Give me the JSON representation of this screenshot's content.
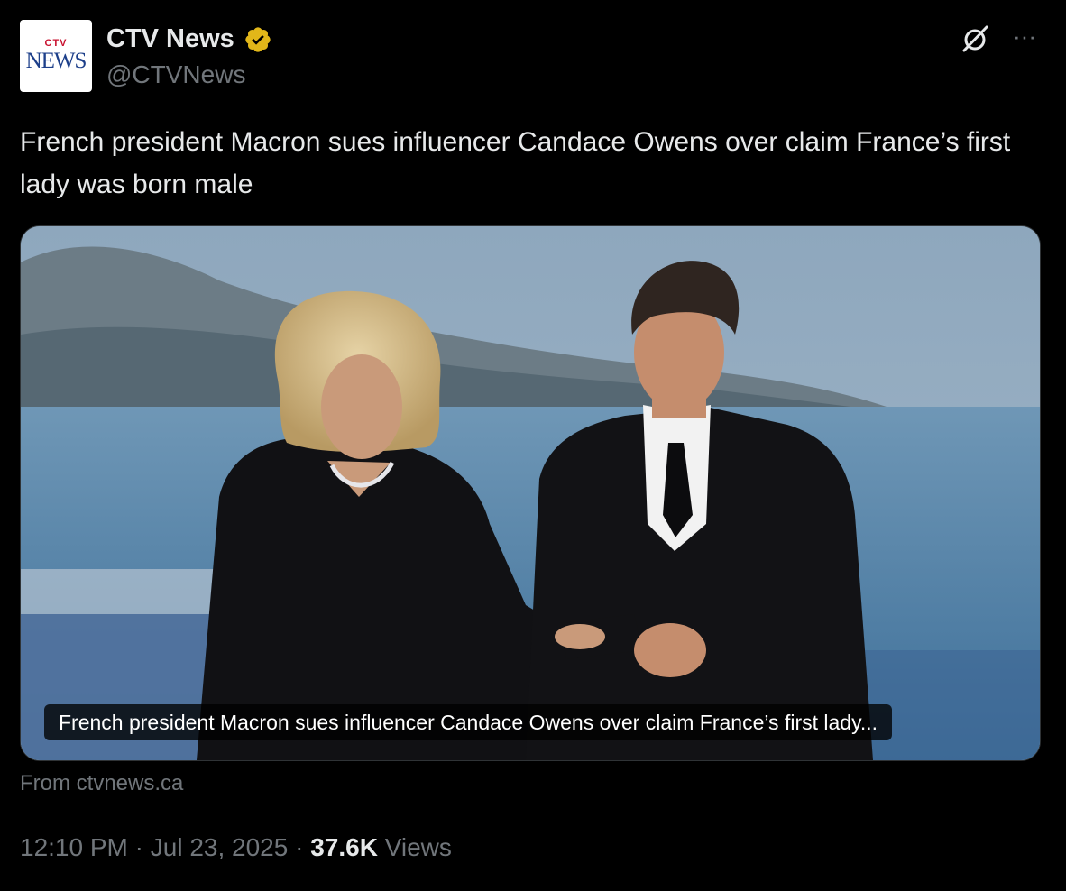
{
  "account": {
    "avatar_line1": "CTV",
    "avatar_line2": "NEWS",
    "display_name": "CTV News",
    "handle": "@CTVNews",
    "verified_color": "#e2b719"
  },
  "actions": {
    "grok_icon": "grok-icon",
    "more_icon": "more-icon",
    "more_label": "···"
  },
  "tweet": {
    "text": "French president Macron sues influencer Candace Owens over claim France’s first lady was born male"
  },
  "card": {
    "caption": "French president Macron sues influencer Candace Owens over claim France’s first lady...",
    "source": "From ctvnews.ca"
  },
  "meta": {
    "time": "12:10 PM",
    "separator1": " · ",
    "date": "Jul 23, 2025",
    "separator2": " · ",
    "views_count": "37.6K",
    "views_label": " Views"
  }
}
